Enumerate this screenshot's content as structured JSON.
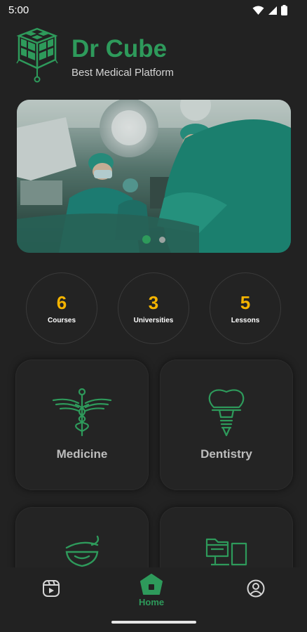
{
  "status_bar": {
    "time": "5:00",
    "icons": [
      "wifi-icon",
      "signal-icon",
      "battery-icon"
    ]
  },
  "header": {
    "logo_icon": "cube-logo-icon",
    "title": "Dr Cube",
    "subtitle": "Best Medical Platform"
  },
  "banner": {
    "image": "surgeons-operating-room-photo",
    "active_slide": 1,
    "slide_count": 2
  },
  "stats": [
    {
      "value": "6",
      "label": "Courses"
    },
    {
      "value": "3",
      "label": "Universities"
    },
    {
      "value": "5",
      "label": "Lessons"
    }
  ],
  "categories": [
    {
      "label": "Medicine",
      "icon": "caduceus-icon"
    },
    {
      "label": "Dentistry",
      "icon": "tooth-implant-icon"
    },
    {
      "label": "",
      "icon": "pharmacy-bowl-icon"
    },
    {
      "label": "",
      "icon": "folder-computer-icon"
    }
  ],
  "bottom_nav": {
    "items": [
      {
        "label": "",
        "icon": "video-icon",
        "active": false
      },
      {
        "label": "Home",
        "icon": "home-icon",
        "active": true
      },
      {
        "label": "",
        "icon": "profile-icon",
        "active": false
      }
    ]
  },
  "colors": {
    "background": "#222222",
    "accent_green": "#2e9a5b",
    "stat_yellow": "#f5b400",
    "card_background": "#242424"
  }
}
